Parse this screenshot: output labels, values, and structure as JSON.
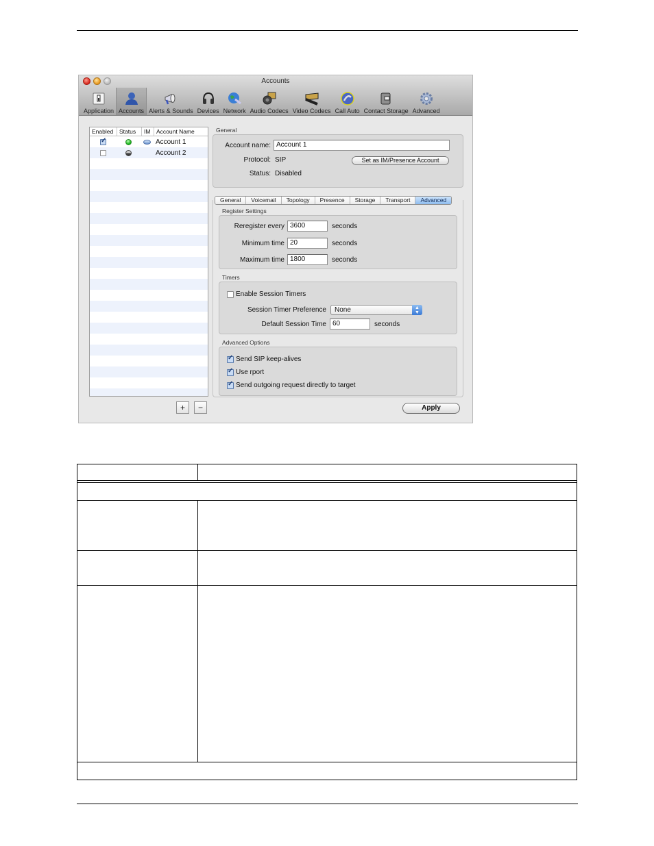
{
  "window": {
    "title": "Accounts",
    "toolbar": [
      {
        "label": "Application",
        "icon": "application-switch-icon",
        "selected": false
      },
      {
        "label": "Accounts",
        "icon": "user-silhouette-icon",
        "selected": true
      },
      {
        "label": "Alerts & Sounds",
        "icon": "megaphone-icon",
        "selected": false
      },
      {
        "label": "Devices",
        "icon": "headset-icon",
        "selected": false
      },
      {
        "label": "Network",
        "icon": "globe-network-icon",
        "selected": false
      },
      {
        "label": "Audio Codecs",
        "icon": "speaker-filmstrip-icon",
        "selected": false
      },
      {
        "label": "Video Codecs",
        "icon": "filmstrip-icon",
        "selected": false
      },
      {
        "label": "Call Auto",
        "icon": "phone-ring-icon",
        "selected": false
      },
      {
        "label": "Contact Storage",
        "icon": "storage-box-icon",
        "selected": false
      },
      {
        "label": "Advanced",
        "icon": "gear-icon",
        "selected": false
      }
    ]
  },
  "accounts_list": {
    "columns": [
      "Enabled",
      "Status",
      "IM",
      "Account Name"
    ],
    "rows": [
      {
        "enabled": true,
        "status": "online",
        "im": true,
        "name": "Account 1"
      },
      {
        "enabled": false,
        "status": "offline",
        "im": false,
        "name": "Account 2"
      }
    ],
    "add_label": "+",
    "remove_label": "−"
  },
  "general": {
    "group_label": "General",
    "account_name_label": "Account name:",
    "account_name_value": "Account 1",
    "protocol_label": "Protocol:",
    "protocol_value": "SIP",
    "status_label": "Status:",
    "status_value": "Disabled",
    "set_im_button": "Set as IM/Presence Account"
  },
  "tabs": [
    {
      "label": "General",
      "active": false
    },
    {
      "label": "Voicemail",
      "active": false
    },
    {
      "label": "Topology",
      "active": false
    },
    {
      "label": "Presence",
      "active": false
    },
    {
      "label": "Storage",
      "active": false
    },
    {
      "label": "Transport",
      "active": false
    },
    {
      "label": "Advanced",
      "active": true
    }
  ],
  "register_settings": {
    "group_label": "Register Settings",
    "reregister_label": "Reregister every",
    "reregister_value": "3600",
    "minimum_label": "Minimum time",
    "minimum_value": "20",
    "maximum_label": "Maximum time",
    "maximum_value": "1800",
    "unit": "seconds"
  },
  "timers": {
    "group_label": "Timers",
    "enable_label": "Enable Session Timers",
    "enable_checked": false,
    "preference_label": "Session Timer Preference",
    "preference_value": "None",
    "default_time_label": "Default Session Time",
    "default_time_value": "60",
    "unit": "seconds"
  },
  "advanced_options": {
    "group_label": "Advanced Options",
    "options": [
      {
        "label": "Send SIP keep-alives",
        "checked": true
      },
      {
        "label": "Use rport",
        "checked": true
      },
      {
        "label": "Send outgoing request directly to target",
        "checked": true
      }
    ]
  },
  "apply_button": "Apply"
}
